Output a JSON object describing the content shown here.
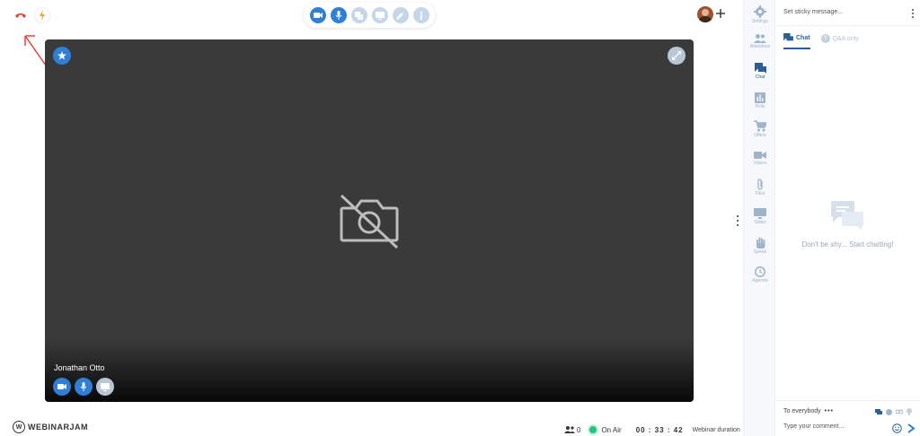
{
  "toolbar": {
    "buttons": [
      {
        "icon": "camera-icon",
        "state": "active"
      },
      {
        "icon": "microphone-icon",
        "state": "active"
      },
      {
        "icon": "copy-icon",
        "state": "inactive"
      },
      {
        "icon": "screen-share-icon",
        "state": "inactive"
      },
      {
        "icon": "pencil-icon",
        "state": "inactive"
      },
      {
        "icon": "info-icon",
        "state": "inactive"
      }
    ]
  },
  "stage": {
    "presenter_name": "Jonathan Otto",
    "background": "#3a3a3a"
  },
  "rail": {
    "items": [
      {
        "label": "Settings",
        "icon": "gear-icon",
        "active": false
      },
      {
        "label": "Attendees",
        "icon": "people-icon",
        "active": false
      },
      {
        "label": "Chat",
        "icon": "chat-icon",
        "active": true
      },
      {
        "label": "Polls",
        "icon": "poll-icon",
        "active": false
      },
      {
        "label": "Offers",
        "icon": "cart-icon",
        "active": false
      },
      {
        "label": "Videos",
        "icon": "video-icon",
        "active": false
      },
      {
        "label": "Files",
        "icon": "paperclip-icon",
        "active": false
      },
      {
        "label": "Slides",
        "icon": "slides-icon",
        "active": false
      },
      {
        "label": "Speak",
        "icon": "hand-icon",
        "active": false
      },
      {
        "label": "Agenda",
        "icon": "clock-icon",
        "active": false
      }
    ]
  },
  "chat": {
    "sticky_placeholder": "Set sticky message...",
    "tabs": {
      "chat": "Chat",
      "qa": "Q&A only",
      "qa_badge": "?"
    },
    "empty_text": "Don't be shy... Start chatting!",
    "to_everybody": "To everybody",
    "dots": "•••",
    "comment_placeholder": "Type your comment..."
  },
  "footer": {
    "logo_text": "WEBINARJAM",
    "logo_mark": "W",
    "attendee_count": "0",
    "on_air": "On Air",
    "timer": "00 : 33 : 42",
    "duration_label": "Webinar duration"
  },
  "colors": {
    "accent": "#2f7fd6",
    "on_air": "#23c37a",
    "hangup": "#e0433a",
    "bolt": "#f2a233",
    "annotation": "#e53935"
  }
}
